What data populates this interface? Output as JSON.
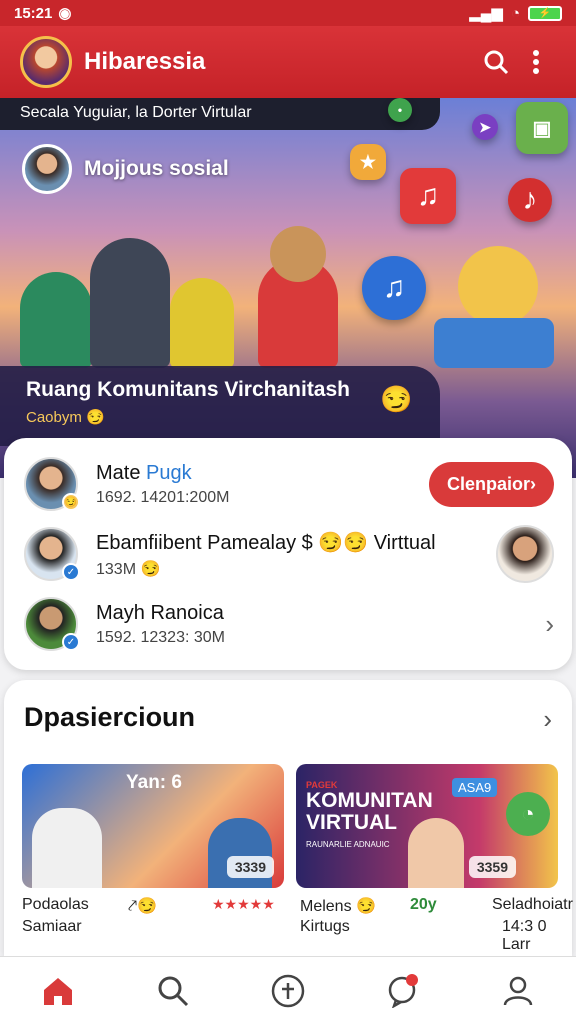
{
  "status": {
    "time": "15:21",
    "battery": "⚡"
  },
  "app": {
    "title": "Hibaressia"
  },
  "hero": {
    "tagline": "Secala Yuguiar, la Dorter Virtular",
    "username": "Mojjous sosial",
    "caption_title": "Ruang Komunitans Virchanitash",
    "caption_sub": "Caobym"
  },
  "posts": [
    {
      "name": "Mate ",
      "name_hl": "Pugk",
      "meta": "1692. 14201:200M",
      "action": "Clenpaior›"
    },
    {
      "name": "Ebamfiibent Pamealay $ 😏😏 Virttual",
      "meta": "133M"
    },
    {
      "name": "Mayh Ranoica",
      "meta": "1592. 12323: 30M"
    }
  ],
  "section": {
    "title": "Dpasiercioun",
    "items": [
      {
        "overlay": "Yan: 6",
        "count": "3339",
        "label1": "Podaolas",
        "label2": "Samiaar",
        "stars": "★★★★★"
      },
      {
        "overlay": "KOMUNITAN VIRTUAL",
        "tag": "ASA9",
        "sublabel": "PAGEK",
        "caption": "RAUNARLIE ADNAUIC",
        "count": "3359",
        "label1": "Melens 😏",
        "label2": "Kirtugs",
        "score": "20y",
        "label3": "Seladhoiatr",
        "label4": "14:3 0 Larr"
      }
    ]
  },
  "colors": {
    "primary": "#c8262b",
    "accent": "#2a7ad3"
  }
}
